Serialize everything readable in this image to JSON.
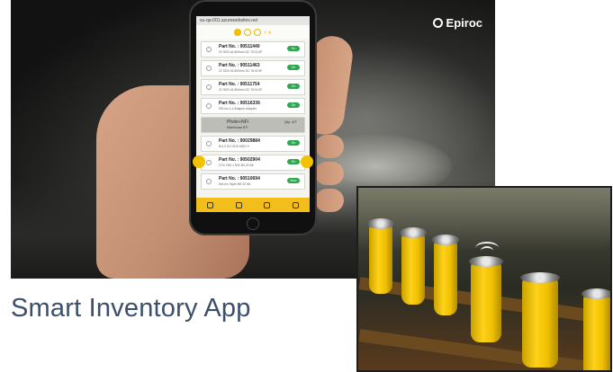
{
  "brand": {
    "name": "Epiroc",
    "logo_icon": "epiroc-logo-icon"
  },
  "caption": "Smart Inventory App",
  "phone": {
    "url": "su-qa-001.azurewebsites.net",
    "stepper_arrow": "›  »",
    "parts": [
      {
        "part": "Part No. : 90511440",
        "desc": "20 SDS x5-600mm DC 78 M-SF",
        "action": "On"
      },
      {
        "part": "Part No. : 90511463",
        "desc": "22 SDS x5-500mm DC 78 M-SF",
        "action": "On"
      },
      {
        "part": "Part No. : 90511754",
        "desc": "22 SDS x5-500mm DC 78 M-SF",
        "action": "On"
      },
      {
        "part": "Part No. : 90516336",
        "desc": "SM-Ins 4-4 Adaptor Adapter",
        "action": "On"
      }
    ],
    "gray_row": {
      "line1": "Photo+NFI",
      "line2": "Warehouse BTI",
      "right": "Qty: 4/T"
    },
    "parts_lower": [
      {
        "part": "Part No. : 90029884",
        "desc": "B-6 5 SG-SDS MSD H",
        "action": "On"
      },
      {
        "part": "Part No. : 90502904",
        "desc": "27m 73th x R32 Bit 24 Bit",
        "action": "On"
      },
      {
        "part": "Part No. : 90510694",
        "desc": "SM-Ins Taper BB 32 Bit",
        "action": "New"
      }
    ],
    "nav_icons": [
      "globe-icon",
      "box-icon",
      "document-icon",
      "cart-icon"
    ]
  },
  "colors": {
    "accent_yellow": "#f2be1c",
    "caption_text": "#3c4f6b",
    "button_green": "#2ea84e"
  }
}
